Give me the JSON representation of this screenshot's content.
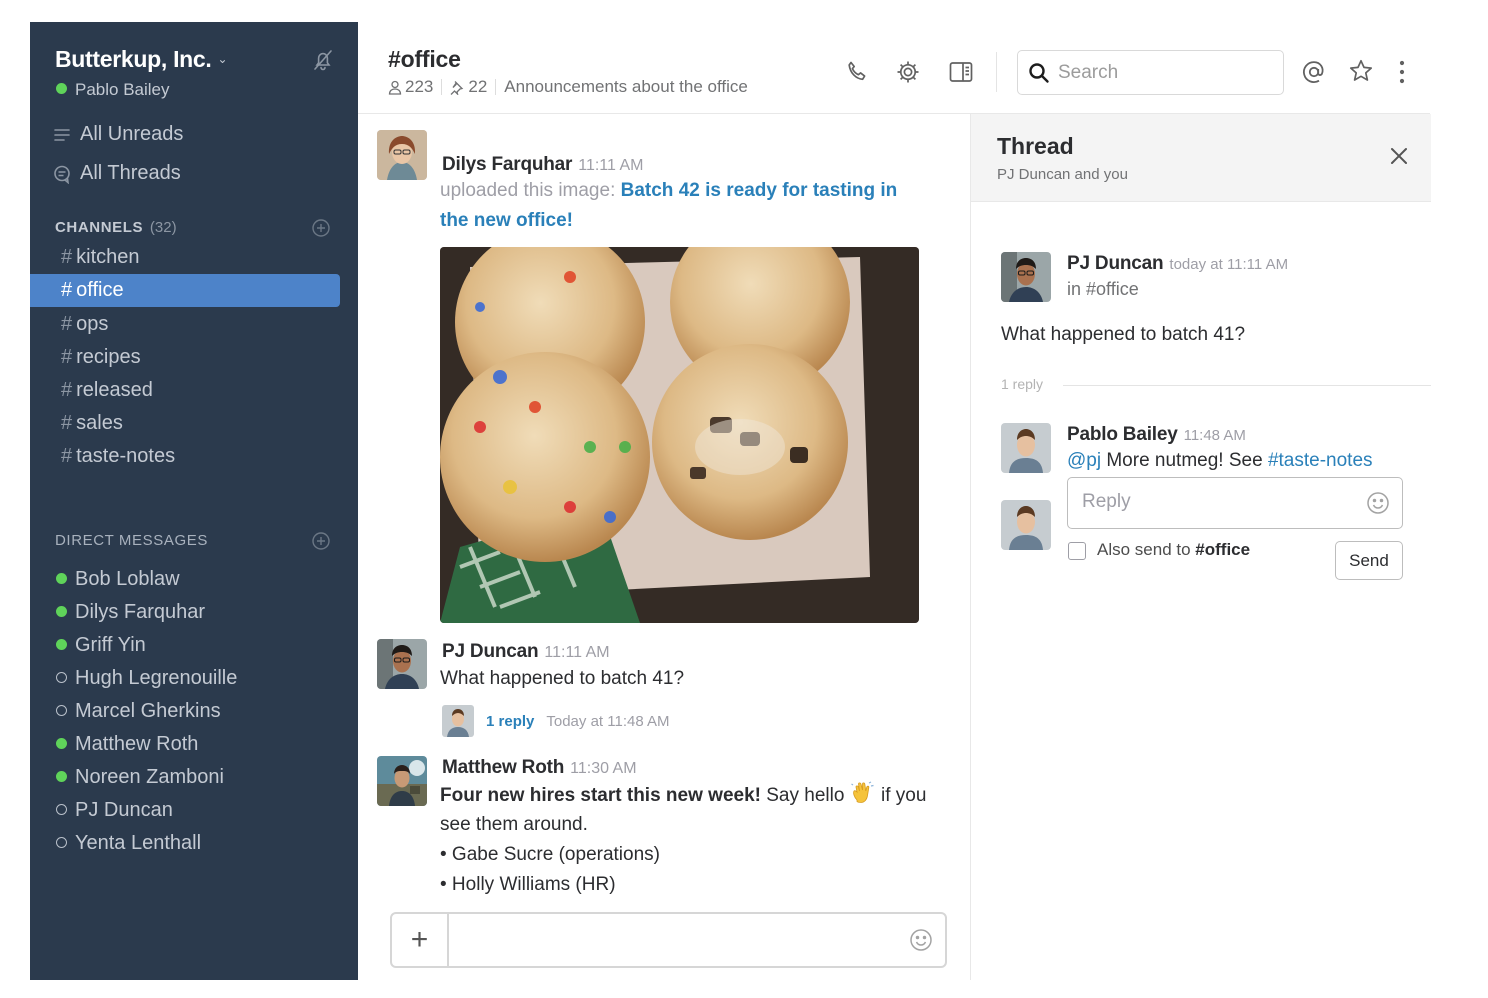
{
  "sidebar": {
    "team_name": "Butterkup, Inc.",
    "user_name": "Pablo Bailey",
    "nav": [
      {
        "label": "All Unreads"
      },
      {
        "label": "All Threads"
      }
    ],
    "channels_header": "CHANNELS",
    "channels_count": "(32)",
    "channels": [
      "kitchen",
      "office",
      "ops",
      "recipes",
      "released",
      "sales",
      "taste-notes"
    ],
    "active_channel": "office",
    "dm_header": "DIRECT MESSAGES",
    "dms": [
      {
        "name": "Bob Loblaw",
        "online": true
      },
      {
        "name": "Dilys Farquhar",
        "online": true
      },
      {
        "name": "Griff Yin",
        "online": true
      },
      {
        "name": "Hugh Legrenouille",
        "online": false
      },
      {
        "name": "Marcel Gherkins",
        "online": false
      },
      {
        "name": "Matthew Roth",
        "online": true
      },
      {
        "name": "Noreen Zamboni",
        "online": true
      },
      {
        "name": "PJ Duncan",
        "online": false
      },
      {
        "name": "Yenta Lenthall",
        "online": false
      }
    ]
  },
  "header": {
    "channel_title": "#office",
    "members": "223",
    "pinned": "22",
    "topic": "Announcements about the office",
    "search_placeholder": "Search"
  },
  "messages": [
    {
      "author": "Dilys Farquhar",
      "time": "11:11 AM",
      "prefix": "uploaded this image:",
      "link_line1": "Batch 42 is ready for tasting in",
      "link_line2": "the new office!"
    },
    {
      "author": "PJ Duncan",
      "time": "11:11 AM",
      "text": "What happened to batch 41?",
      "reply_count": "1 reply",
      "reply_time": "Today at 11:48 AM"
    },
    {
      "author": "Matthew Roth",
      "time": "11:30 AM",
      "line1_bold": "Four new hires start this new week!",
      "line1_rest": "Say hello",
      "line1_end": "if you",
      "line2": "see them around.",
      "bullet1": "• Gabe Sucre (operations)",
      "bullet2": "• Holly Williams (HR)"
    }
  ],
  "thread": {
    "title": "Thread",
    "subtitle": "PJ Duncan and you",
    "parent_author": "PJ Duncan",
    "parent_time": "today at 11:11 AM",
    "parent_channel": "in #office",
    "parent_text": "What happened to batch 41?",
    "reply_count": "1 reply",
    "reply_author": "Pablo Bailey",
    "reply_time": "11:48 AM",
    "reply_mention": "@pj",
    "reply_text": "More nutmeg! See",
    "reply_channel_link": "#taste-notes",
    "reply_placeholder": "Reply",
    "also_send_prefix": "Also send to",
    "also_send_channel": "#office",
    "send_label": "Send"
  },
  "colors": {
    "sidebar_bg": "#2b3a4d",
    "active_channel_bg": "#4d83c9",
    "presence_online": "#5fd35a",
    "link": "#2a80b9"
  }
}
